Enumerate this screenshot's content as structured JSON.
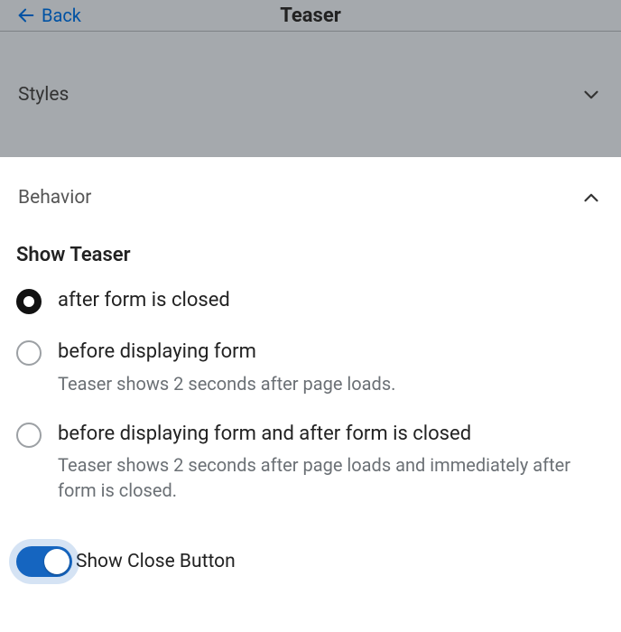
{
  "header": {
    "back_label": "Back",
    "title": "Teaser"
  },
  "sections": {
    "styles": {
      "label": "Styles",
      "expanded": false
    },
    "behavior": {
      "label": "Behavior",
      "expanded": true
    }
  },
  "show_teaser": {
    "group_title": "Show Teaser",
    "options": [
      {
        "label": "after form is closed",
        "description": "",
        "selected": true
      },
      {
        "label": "before displaying form",
        "description": "Teaser shows 2 seconds after page loads.",
        "selected": false
      },
      {
        "label": "before displaying form and after form is closed",
        "description": "Teaser shows 2 seconds after page loads and immediately after form is closed.",
        "selected": false
      }
    ]
  },
  "show_close_button": {
    "label": "Show Close Button",
    "enabled": true
  }
}
